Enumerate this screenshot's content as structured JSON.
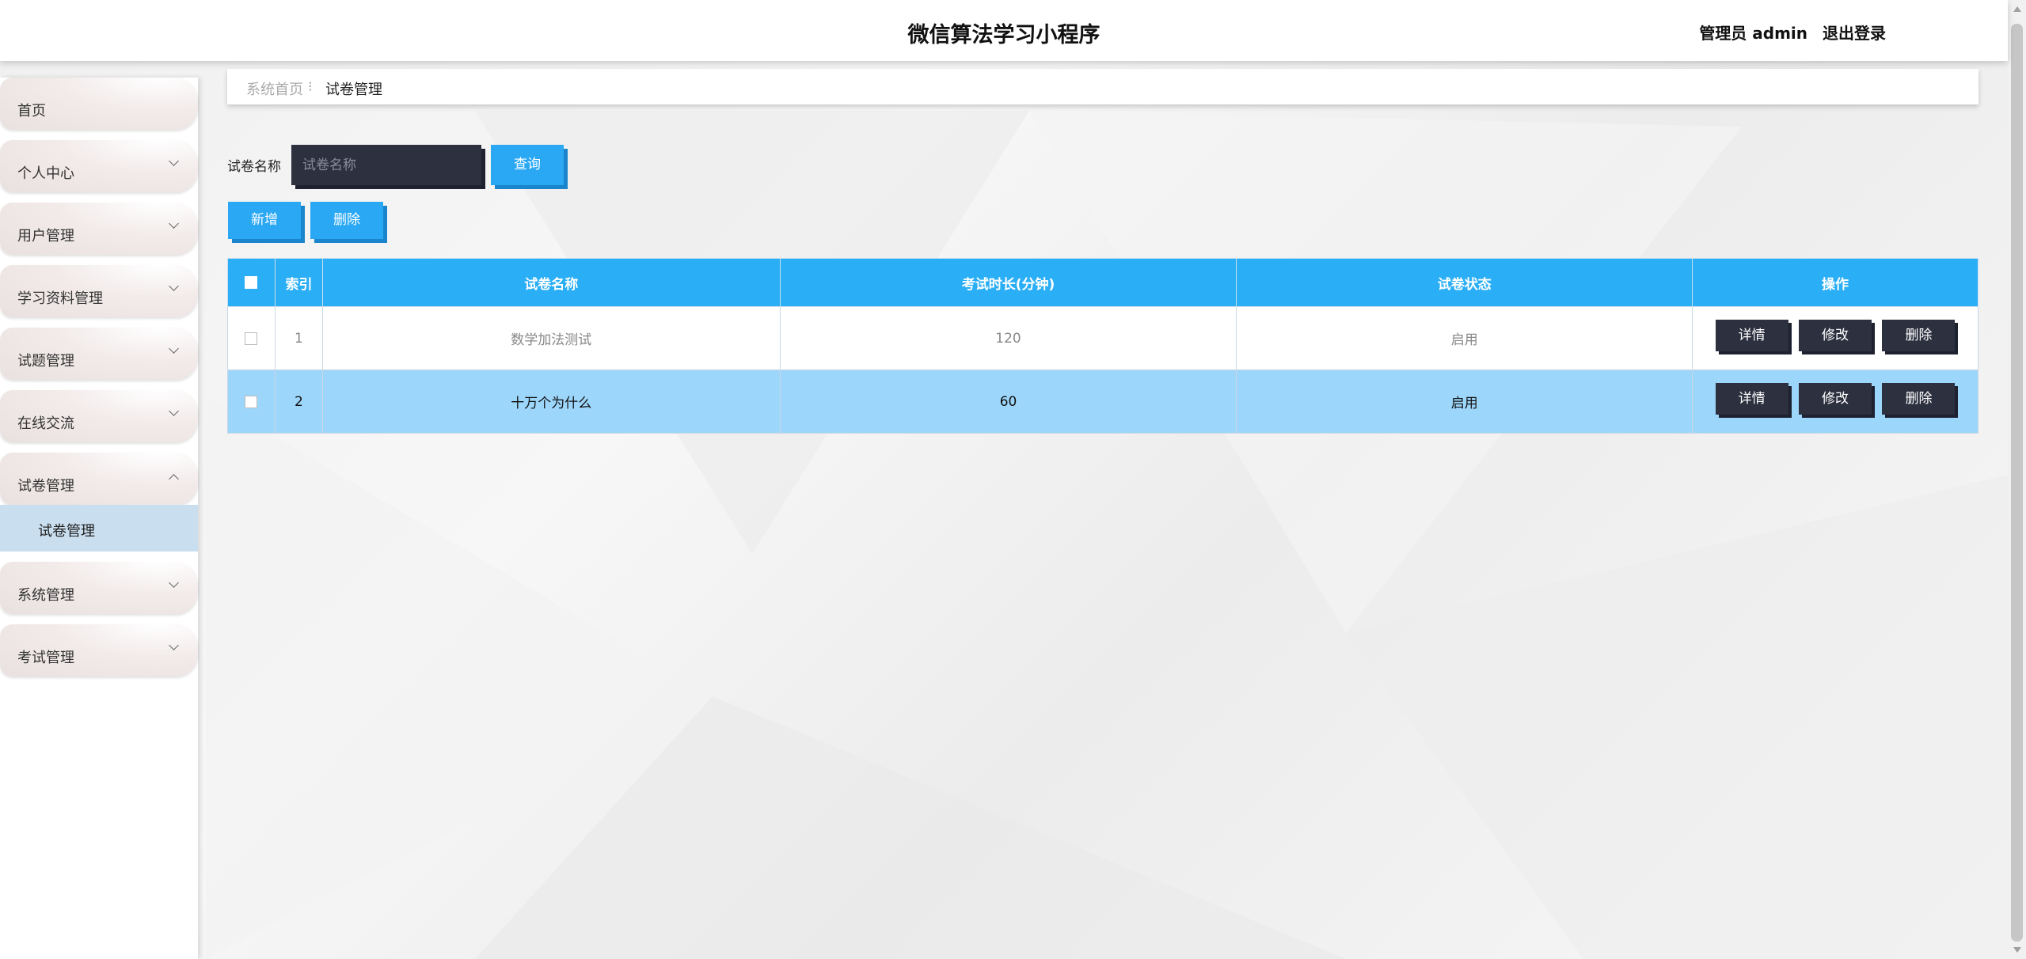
{
  "header": {
    "title": "微信算法学习小程序",
    "user_role": "管理员 admin",
    "logout": "退出登录"
  },
  "sidebar": {
    "items": [
      {
        "label": "首页",
        "expandable": false
      },
      {
        "label": "个人中心",
        "expandable": true
      },
      {
        "label": "用户管理",
        "expandable": true
      },
      {
        "label": "学习资料管理",
        "expandable": true
      },
      {
        "label": "试题管理",
        "expandable": true
      },
      {
        "label": "在线交流",
        "expandable": true
      },
      {
        "label": "试卷管理",
        "expandable": true,
        "expanded": true
      },
      {
        "label": "系统管理",
        "expandable": true
      },
      {
        "label": "考试管理",
        "expandable": true
      }
    ],
    "active_subitem": "试卷管理"
  },
  "breadcrumb": {
    "home": "系统首页",
    "separator": "⁝",
    "current": "试卷管理"
  },
  "search": {
    "label": "试卷名称",
    "placeholder": "试卷名称",
    "query_button": "查询"
  },
  "actions": {
    "add": "新增",
    "delete": "删除"
  },
  "table": {
    "headers": [
      "索引",
      "试卷名称",
      "考试时长(分钟)",
      "试卷状态",
      "操作"
    ],
    "rows": [
      {
        "index": "1",
        "name": "数学加法测试",
        "duration": "120",
        "status": "启用"
      },
      {
        "index": "2",
        "name": "十万个为什么",
        "duration": "60",
        "status": "启用"
      }
    ],
    "row_actions": {
      "detail": "详情",
      "edit": "修改",
      "delete": "删除"
    }
  },
  "colors": {
    "primary_blue": "#2aa8f4",
    "dark_button": "#2d303f",
    "highlight_row": "#9dd6fb",
    "active_submenu": "#c9deef"
  }
}
